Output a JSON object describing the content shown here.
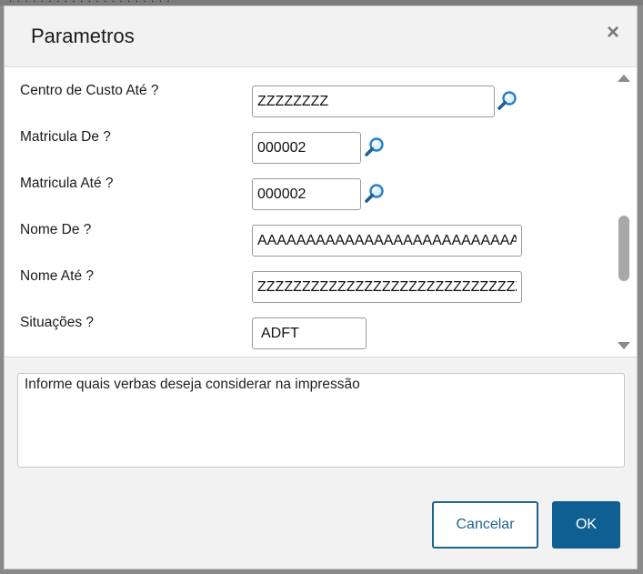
{
  "dialog": {
    "title": "Parametros",
    "close_glyph": "×"
  },
  "fields": [
    {
      "label": "Centro de Custo Até ?",
      "value": "ZZZZZZZZ",
      "lookup": true
    },
    {
      "label": "Matricula De ?",
      "value": "000002",
      "lookup": true
    },
    {
      "label": "Matricula Até ?",
      "value": "000002",
      "lookup": true
    },
    {
      "label": "Nome De ?",
      "value": "AAAAAAAAAAAAAAAAAAAAAAAAAAAAAA",
      "lookup": false
    },
    {
      "label": "Nome Até ?",
      "value": "ZZZZZZZZZZZZZZZZZZZZZZZZZZZZZZ",
      "lookup": false
    },
    {
      "label": "Situações ?",
      "value": "ADFT",
      "lookup": false
    }
  ],
  "help_text": "Informe quais verbas deseja considerar na impressão",
  "buttons": {
    "cancel": "Cancelar",
    "ok": "OK"
  },
  "colors": {
    "primary": "#0f5f93",
    "lookup_icon": "#2a7fc7"
  },
  "icons": {
    "lookup": "magnifier-icon",
    "close": "close-icon"
  }
}
